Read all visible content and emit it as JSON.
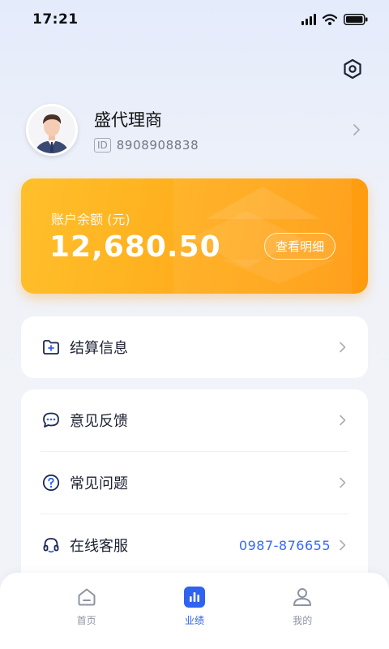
{
  "status_bar": {
    "time": "17:21",
    "icons": [
      "signal-icon",
      "wifi-icon",
      "battery-icon"
    ]
  },
  "header": {
    "settings_icon": "settings-icon"
  },
  "profile": {
    "name": "盛代理商",
    "id_tag": "ID",
    "id_value": "8908908838"
  },
  "balance": {
    "label": "账户余额 (元)",
    "amount": "12,680.50",
    "detail_button": "查看明细"
  },
  "menu": {
    "settlement": {
      "label": "结算信息",
      "icon": "folder-plus-icon"
    },
    "feedback": {
      "label": "意见反馈",
      "icon": "chat-icon"
    },
    "faq": {
      "label": "常见问题",
      "icon": "question-icon"
    },
    "support": {
      "label": "在线客服",
      "icon": "headset-icon",
      "value": "0987-876655"
    }
  },
  "tabbar": {
    "tabs": [
      {
        "label": "首页",
        "icon": "home-icon",
        "active": false
      },
      {
        "label": "业绩",
        "icon": "chart-icon",
        "active": true
      },
      {
        "label": "我的",
        "icon": "user-icon",
        "active": false
      }
    ]
  },
  "colors": {
    "accent": "#2e63f2",
    "card_orange": "#ffad1c",
    "phone_value": "#3368ff"
  }
}
